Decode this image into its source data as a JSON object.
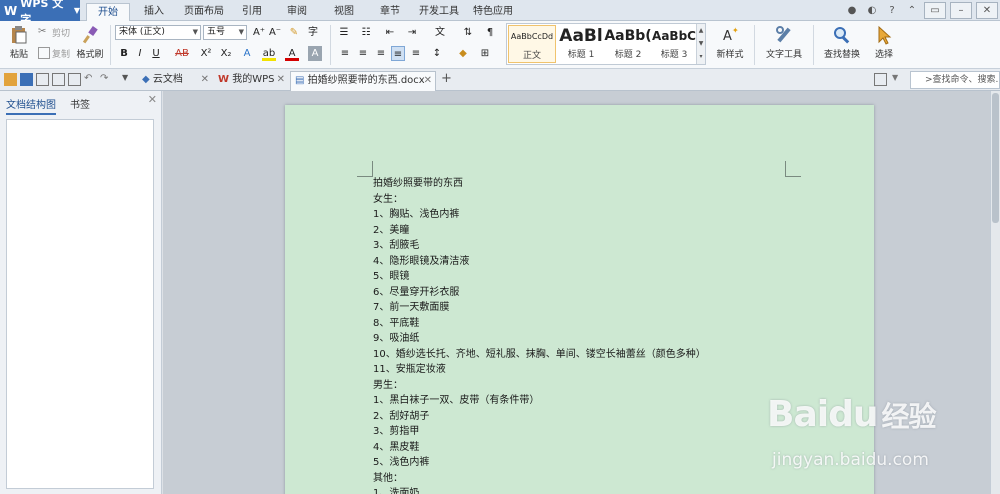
{
  "app": {
    "name": "WPS 文字"
  },
  "ribbon_tabs": [
    "开始",
    "插入",
    "页面布局",
    "引用",
    "审阅",
    "视图",
    "章节",
    "开发工具",
    "特色应用"
  ],
  "ribbon": {
    "paste": "粘贴",
    "cut": "剪切",
    "copy": "复制",
    "format_painter": "格式刷",
    "font_name": "宋体 (正文)",
    "font_size": "五号",
    "bold": "B",
    "italic": "I",
    "underline": "U",
    "strike": "AB",
    "superscript": "X²",
    "subscript": "X₂",
    "styles": [
      {
        "preview": "AaBbCcDd",
        "name": "正文"
      },
      {
        "preview": "AaBl",
        "name": "标题 1"
      },
      {
        "preview": "AaBb(",
        "name": "标题 2"
      },
      {
        "preview": "AaBbC",
        "name": "标题 3"
      }
    ],
    "new_style": "新样式",
    "text_tools": "文字工具",
    "find_replace": "查找替换",
    "select": "选择"
  },
  "doc_tabs": [
    {
      "label": "云文档"
    },
    {
      "label": "我的WPS"
    },
    {
      "label": "拍婚纱照要带的东西.docx"
    }
  ],
  "command_search": ">查找命令、搜索..",
  "navpane": {
    "tab_outline": "文档结构图",
    "tab_bookmarks": "书签"
  },
  "document": {
    "lines": [
      "拍婚纱照要带的东西",
      "女生：",
      "1、胸贴、浅色内裤",
      "2、美瞳",
      "3、刮腋毛",
      "4、隐形眼镜及清洁液",
      "5、眼镜",
      "6、尽量穿开衫衣服",
      "7、前一天敷面膜",
      "8、平底鞋",
      "9、吸油纸",
      "10、婚纱选长托、齐地、短礼服、抹胸、单间、镂空长袖蕾丝（颜色多种）",
      "11、安瓶定妆液",
      "男生：",
      "1、黑白袜子一双、皮带（有条件带）",
      "2、刮好胡子",
      "3、剪指甲",
      "4、黑皮鞋",
      "5、浅色内裤",
      "其他：",
      "1、洗面奶"
    ]
  },
  "watermark": {
    "brand": "Baidu",
    "cn": "经验",
    "url": "jingyan.baidu.com"
  },
  "colors": {
    "accent": "#3b6fb6",
    "page": "#cde8d2",
    "workspace": "#c7cdd4"
  }
}
